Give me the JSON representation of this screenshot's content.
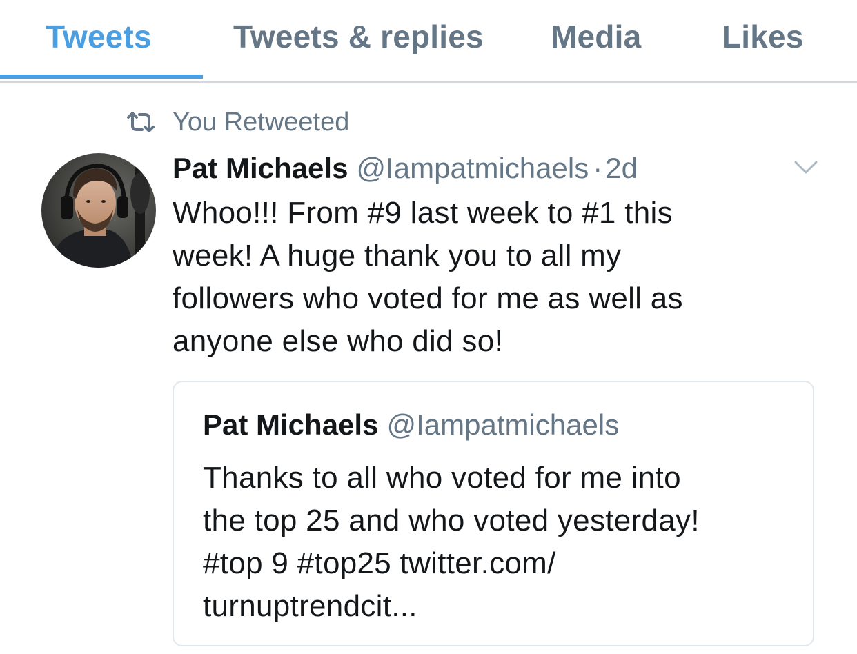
{
  "tabs": [
    {
      "label": "Tweets",
      "active": true
    },
    {
      "label": "Tweets & replies",
      "active": false
    },
    {
      "label": "Media",
      "active": false
    },
    {
      "label": "Likes",
      "active": false
    }
  ],
  "colors": {
    "accent": "#4a9fe2",
    "secondary_text": "#657786",
    "primary_text": "#14171a",
    "border": "#e1e8ed"
  },
  "retweet_context": {
    "icon": "retweet-icon",
    "label": "You Retweeted"
  },
  "tweet": {
    "avatar": "avatar-photo",
    "author_name": "Pat Michaels",
    "author_handle": "@Iampatmichaels",
    "separator": "·",
    "timestamp": "2d",
    "menu_icon": "chevron-down-icon",
    "text_lines": [
      "Whoo!!! From #9 last week to #1 this",
      "week! A huge thank you to all my",
      "followers who voted for me as well as",
      "anyone else who did so!"
    ]
  },
  "quoted_tweet": {
    "author_name": "Pat Michaels",
    "author_handle": "@Iampatmichaels",
    "text_lines": [
      "Thanks to all who voted for me into",
      "the top 25 and who voted yesterday!",
      "#top 9 #top25 twitter.com/",
      "turnuptrendcit..."
    ]
  }
}
